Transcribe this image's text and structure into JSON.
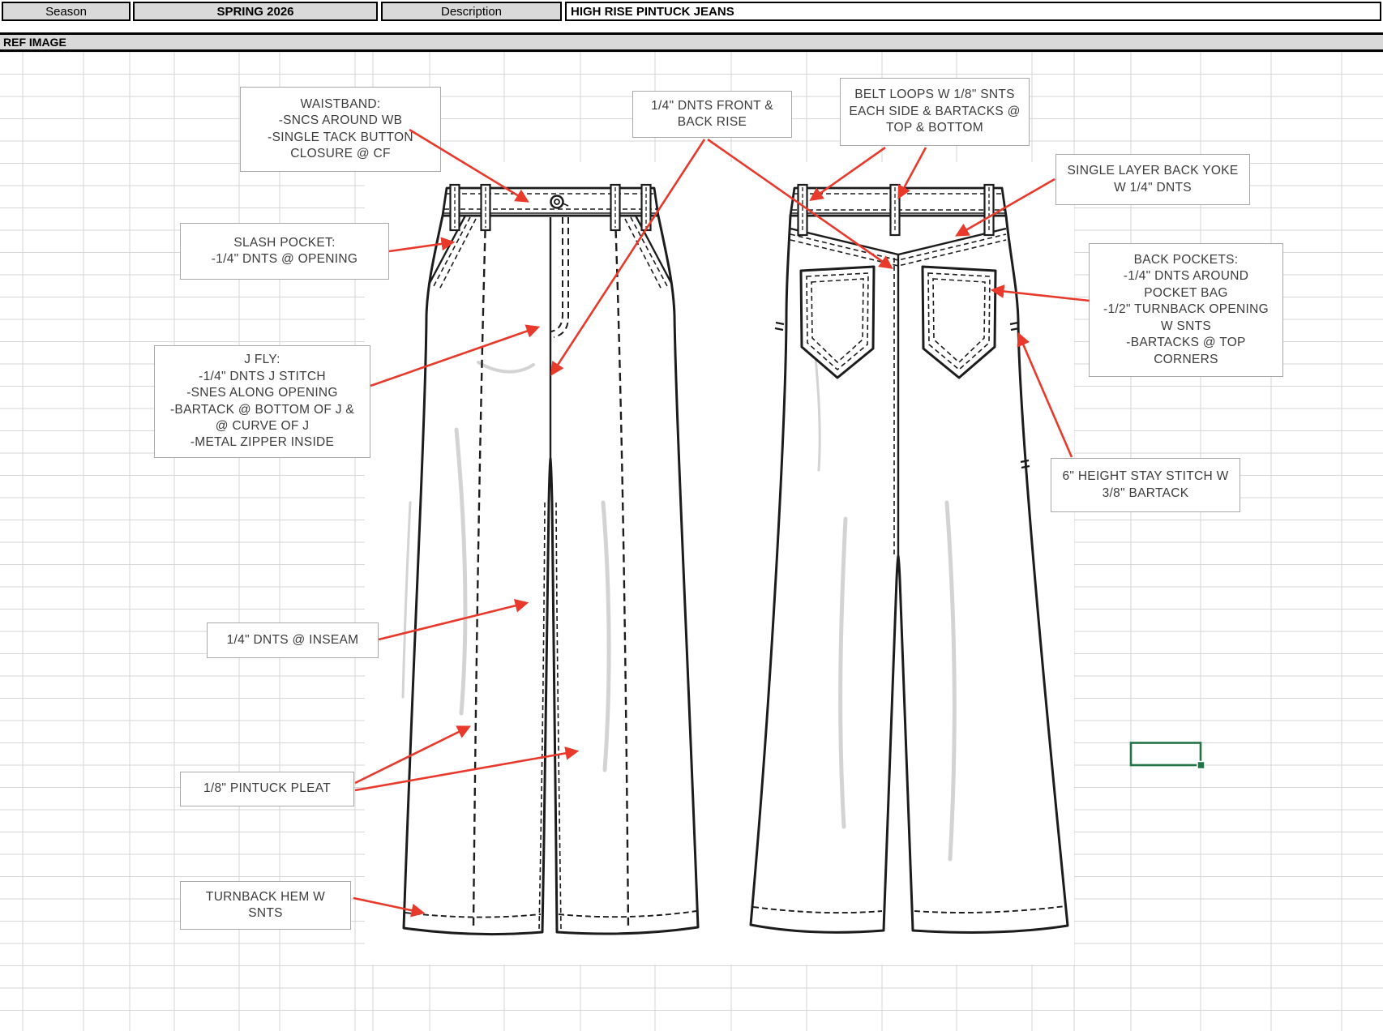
{
  "header": {
    "season_label": "Season",
    "season_value": "SPRING 2026",
    "description_label": "Description",
    "description_value": "HIGH RISE PINTUCK JEANS"
  },
  "section": {
    "ref_image_label": "REF IMAGE"
  },
  "callouts": {
    "waistband": "WAISTBAND:\n-SNCS AROUND WB\n-SINGLE TACK BUTTON\nCLOSURE @ CF",
    "rise": "1/4\" DNTS FRONT &\nBACK RISE",
    "belt_loops": "BELT LOOPS W 1/8\" SNTS\nEACH SIDE & BARTACKS @\nTOP & BOTTOM",
    "back_yoke": "SINGLE LAYER BACK YOKE\nW 1/4\" DNTS",
    "back_pockets": "BACK POCKETS:\n-1/4\" DNTS AROUND\nPOCKET BAG\n-1/2\" TURNBACK OPENING\nW SNTS\n-BARTACKS @ TOP\nCORNERS",
    "slash_pocket": "SLASH POCKET:\n-1/4\" DNTS @ OPENING",
    "j_fly": "J FLY:\n-1/4\" DNTS J STITCH\n-SNES ALONG OPENING\n-BARTACK @ BOTTOM OF J &\n@ CURVE OF J\n-METAL ZIPPER INSIDE",
    "stay_stitch": "6\" HEIGHT STAY STITCH W\n3/8\" BARTACK",
    "inseam": "1/4\" DNTS @ INSEAM",
    "pintuck": "1/8\" PINTUCK PLEAT",
    "hem": "TURNBACK HEM W\nSNTS"
  },
  "colors": {
    "arrow": "#e8392b",
    "selection": "#217346",
    "grid": "#d6d6d6",
    "header_fill": "#d9d9d9",
    "line": "#1c1c1c"
  },
  "icons": {
    "arrowhead": "red-annotation-arrow",
    "fill_handle": "excel-fill-handle"
  }
}
